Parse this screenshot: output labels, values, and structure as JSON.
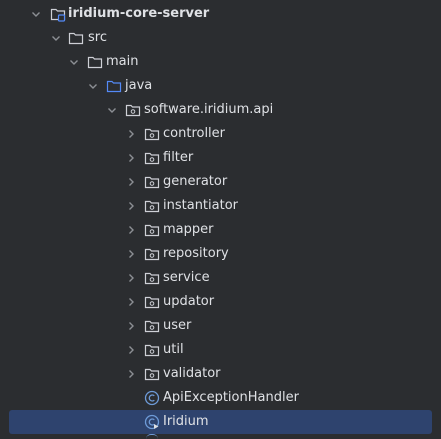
{
  "project_tree": {
    "module": {
      "label": "iridium-core-server",
      "expanded": true
    },
    "src": {
      "label": "src",
      "expanded": true
    },
    "main": {
      "label": "main",
      "expanded": true
    },
    "java": {
      "label": "java",
      "expanded": true
    },
    "package": {
      "label": "software.iridium.api",
      "expanded": true
    },
    "subpackages": [
      {
        "label": "controller"
      },
      {
        "label": "filter"
      },
      {
        "label": "generator"
      },
      {
        "label": "instantiator"
      },
      {
        "label": "mapper"
      },
      {
        "label": "repository"
      },
      {
        "label": "service"
      },
      {
        "label": "updator"
      },
      {
        "label": "user"
      },
      {
        "label": "util"
      },
      {
        "label": "validator"
      }
    ],
    "classes": [
      {
        "label": "ApiExceptionHandler",
        "icon": "class-icon",
        "selected": false
      },
      {
        "label": "Iridium",
        "icon": "runnable-class-icon",
        "selected": true
      }
    ]
  },
  "colors": {
    "background": "#2b2d30",
    "selection": "#2e436e",
    "text": "#dfe1e5",
    "chevron": "#8c8f94",
    "folder": "#ced0d6",
    "source_folder": "#548af7",
    "class_icon": "#6e9bd8"
  }
}
